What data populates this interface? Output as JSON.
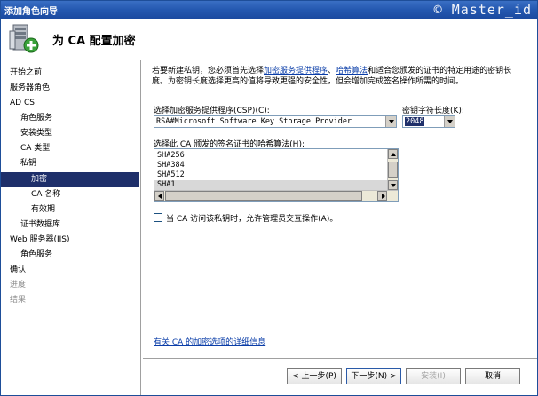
{
  "window": {
    "title": "添加角色向导",
    "watermark": "© Master_id"
  },
  "header": {
    "heading": "为 CA 配置加密"
  },
  "sidebar": {
    "items": [
      {
        "label": "开始之前",
        "state": "normal"
      },
      {
        "label": "服务器角色",
        "state": "normal"
      },
      {
        "label": "AD CS",
        "state": "normal"
      },
      {
        "label": "角色服务",
        "state": "normal"
      },
      {
        "label": "安装类型",
        "state": "normal"
      },
      {
        "label": "CA 类型",
        "state": "normal"
      },
      {
        "label": "私钥",
        "state": "normal"
      },
      {
        "label": "加密",
        "state": "selected"
      },
      {
        "label": "CA 名称",
        "state": "normal"
      },
      {
        "label": "有效期",
        "state": "normal"
      },
      {
        "label": "证书数据库",
        "state": "normal"
      },
      {
        "label": "Web 服务器(IIS)",
        "state": "normal"
      },
      {
        "label": "角色服务",
        "state": "normal"
      },
      {
        "label": "确认",
        "state": "normal"
      },
      {
        "label": "进度",
        "state": "disabled"
      },
      {
        "label": "结果",
        "state": "disabled"
      }
    ]
  },
  "main": {
    "intro_before": "若要新建私钥，您必须首先选择",
    "intro_link1": "加密服务提供程序",
    "intro_sep": "、",
    "intro_link2": "哈希算法",
    "intro_after": "和适合您颁发的证书的特定用途的密钥长度。为密钥长度选择更高的值将导致更强的安全性，但会增加完成签名操作所需的时间。",
    "csp_label": "选择加密服务提供程序(CSP)(C):",
    "csp_value": "RSA#Microsoft Software Key Storage Provider",
    "keylen_label": "密钥字符长度(K):",
    "keylen_value": "2048",
    "hash_label": "选择此 CA 颁发的签名证书的哈希算法(H):",
    "hash_options": [
      "SHA256",
      "SHA384",
      "SHA512",
      "SHA1"
    ],
    "hash_selected": "SHA1",
    "checkbox_label": "当 CA 访问该私钥时，允许管理员交互操作(A)。",
    "checkbox_checked": false,
    "details_link": "有关 CA 的加密选项的详细信息"
  },
  "buttons": {
    "prev": "< 上一步(P)",
    "next": "下一步(N) >",
    "install": "安装(I)",
    "cancel": "取消"
  },
  "colors": {
    "titlebar": "#2458b0",
    "selection": "#1e2f6a",
    "link": "#0a3da8"
  }
}
